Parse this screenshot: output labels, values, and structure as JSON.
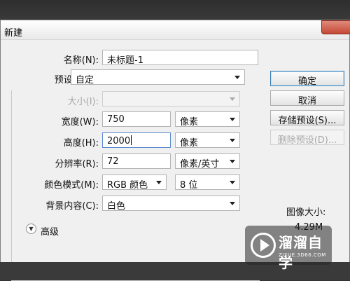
{
  "dialog": {
    "title": "新建"
  },
  "form": {
    "name": {
      "label": "名称(N):",
      "value": "未标题-1"
    },
    "preset": {
      "label": "预设(P):",
      "value": "自定"
    },
    "size": {
      "label": "大小(I):",
      "value": ""
    },
    "width": {
      "label": "宽度(W):",
      "value": "750",
      "unit": "像素"
    },
    "height": {
      "label": "高度(H):",
      "value": "2000",
      "unit": "像素"
    },
    "resolution": {
      "label": "分辨率(R):",
      "value": "72",
      "unit": "像素/英寸"
    },
    "color_mode": {
      "label": "颜色模式(M):",
      "value": "RGB 颜色",
      "depth": "8 位"
    },
    "background": {
      "label": "背景内容(C):",
      "value": "白色"
    },
    "advanced_label": "高级"
  },
  "buttons": {
    "ok": "确定",
    "cancel": "取消",
    "save_preset": "存储预设(S)...",
    "delete_preset": "删除预设(D)..."
  },
  "image_size": {
    "label": "图像大小:",
    "value": "4.29M"
  },
  "watermark": {
    "text": "溜溜自学",
    "sub": "ZIXUE.3D66.COM"
  }
}
